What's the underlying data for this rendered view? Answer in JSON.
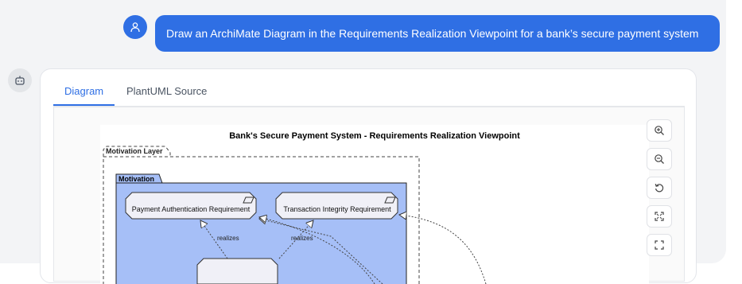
{
  "chat": {
    "user_message": "Draw an ArchiMate Diagram in the Requirements Realization Viewpoint for a bank’s secure payment system"
  },
  "tabs": [
    {
      "label": "Diagram",
      "active": true
    },
    {
      "label": "PlantUML Source",
      "active": false
    }
  ],
  "diagram": {
    "title": "Bank's Secure Payment System - Requirements Realization Viewpoint",
    "outer_group_label": "Motivation Layer",
    "inner_group_label": "Motivation",
    "requirements": [
      {
        "label": "Payment Authentication Requirement"
      },
      {
        "label": "Transaction Integrity Requirement"
      }
    ],
    "relation_labels": [
      "realizes",
      "realizes"
    ]
  },
  "toolbar": {
    "buttons": [
      {
        "name": "zoom-in-button",
        "icon": "zoom-in-icon"
      },
      {
        "name": "zoom-out-button",
        "icon": "zoom-out-icon"
      },
      {
        "name": "reset-button",
        "icon": "reset-icon"
      },
      {
        "name": "fit-button",
        "icon": "fit-view-icon"
      },
      {
        "name": "fullscreen-button",
        "icon": "fullscreen-icon"
      }
    ]
  },
  "colors": {
    "accent": "#2f6fe4",
    "motivation_fill": "#a6bff7",
    "requirement_fill": "#f0f0f7"
  }
}
